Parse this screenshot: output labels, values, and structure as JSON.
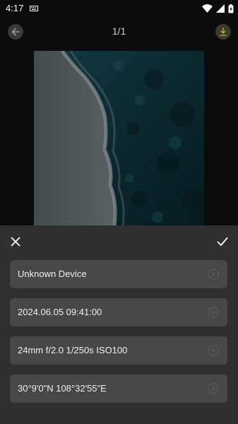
{
  "status": {
    "time": "4:17"
  },
  "header": {
    "page_counter": "1/1"
  },
  "fields": [
    {
      "value": "Unknown Device"
    },
    {
      "value": "2024.06.05 09:41:00"
    },
    {
      "value": "24mm f/2.0 1/250s ISO100"
    },
    {
      "value": "30°9'0\"N 108°32'55\"E"
    }
  ],
  "colors": {
    "sheet_bg": "#2f2f2f",
    "field_bg": "#474747",
    "download_accent": "#c9a227"
  },
  "icons": [
    "back-arrow-icon",
    "download-icon",
    "close-icon",
    "check-icon",
    "clear-icon"
  ]
}
